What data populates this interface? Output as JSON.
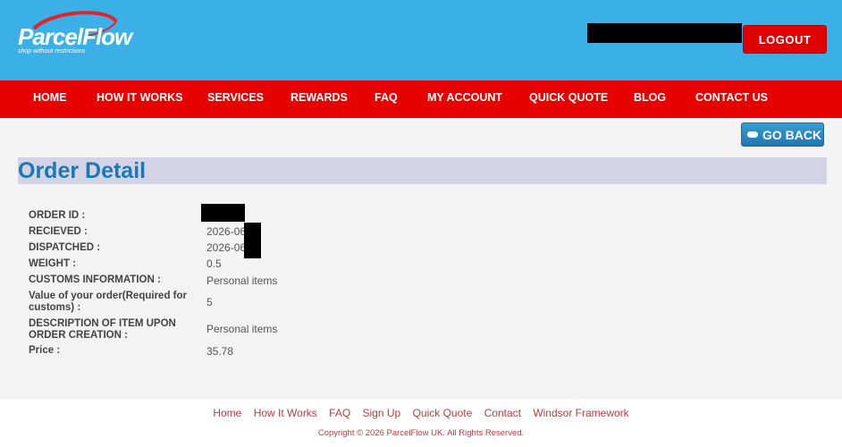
{
  "brand": {
    "name": "ParcelFlow",
    "tagline": "shop without restrictions"
  },
  "header": {
    "logout_label": "LOGOUT"
  },
  "nav": [
    {
      "label": "HOME"
    },
    {
      "label": "HOW IT WORKS"
    },
    {
      "label": "SERVICES"
    },
    {
      "label": "REWARDS"
    },
    {
      "label": "FAQ"
    },
    {
      "label": "MY ACCOUNT"
    },
    {
      "label": "QUICK QUOTE"
    },
    {
      "label": "BLOG"
    },
    {
      "label": "CONTACT US"
    }
  ],
  "go_back_label": "GO BACK",
  "page_title": "Order Detail",
  "details": {
    "order_id": {
      "label": "ORDER ID :",
      "value": ""
    },
    "received": {
      "label": "RECIEVED :",
      "value": "2026-06"
    },
    "dispatched": {
      "label": "DISPATCHED :",
      "value": "2026-06"
    },
    "weight": {
      "label": "WEIGHT :",
      "value": "0.5"
    },
    "customs_info": {
      "label": "CUSTOMS INFORMATION :",
      "value": "Personal items"
    },
    "order_value": {
      "label": "Value of your order(Required for customs) :",
      "value": "5"
    },
    "description": {
      "label": "DESCRIPTION OF ITEM UPON ORDER CREATION :",
      "value": "Personal items"
    },
    "price": {
      "label": "Price :",
      "value": "35.78"
    }
  },
  "footer": {
    "links": [
      {
        "label": "Home"
      },
      {
        "label": "How It Works"
      },
      {
        "label": "FAQ"
      },
      {
        "label": "Sign Up"
      },
      {
        "label": "Quick Quote"
      },
      {
        "label": "Contact"
      },
      {
        "label": "Windsor Framework"
      }
    ],
    "copyright": "Copyright © 2026 ParcelFlow UK. All Rights Reserved."
  },
  "colors": {
    "header_bg": "#3bb0e6",
    "nav_bg": "#e60000",
    "title": "#1c77b5",
    "footer_link": "#b04040"
  }
}
